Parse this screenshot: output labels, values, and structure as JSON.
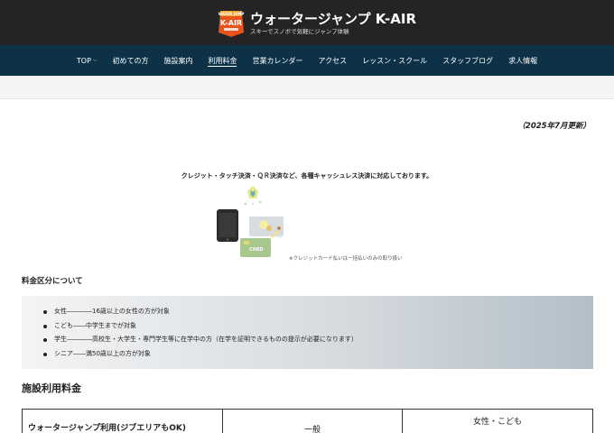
{
  "header": {
    "logo_text_top": "WATER JUMP",
    "logo_text_main": "K-AIR",
    "title": "ウォータージャンプ K-AIR",
    "subtitle": "スキーでスノボで気軽にジャンプ体験"
  },
  "nav": {
    "items": [
      {
        "label": "TOP",
        "has_dropdown": true
      },
      {
        "label": "初めての方"
      },
      {
        "label": "施設案内"
      },
      {
        "label": "利用料金",
        "active": true
      },
      {
        "label": "営業カレンダー"
      },
      {
        "label": "アクセス"
      },
      {
        "label": "レッスン・スクール"
      },
      {
        "label": "スタッフブログ"
      },
      {
        "label": "求人情報"
      }
    ]
  },
  "content": {
    "updated": "（2025年7月更新）",
    "cashless": "クレジット・タッチ決済・ＱＲ決済など、各種キャッシュレス決済に対応しております。",
    "card_label": "CARD",
    "illus_note": "※クレジットカード払いは一括払いのみの取り扱い",
    "section1": "料金区分について",
    "categories": [
      "女性――――16歳以上の女性の方が対象",
      "こども――中学生までが対象",
      "学生――――高校生・大学生・専門学生等に在学中の方（在学を証明できるものの提示が必要になります）",
      "シニア――満50歳以上の方が対象"
    ],
    "section2": "施設利用料金",
    "table": {
      "col1": "ウォータージャンプ利用(ジブエリアもOK)",
      "col2": "一般",
      "col3": "女性・こども"
    }
  }
}
